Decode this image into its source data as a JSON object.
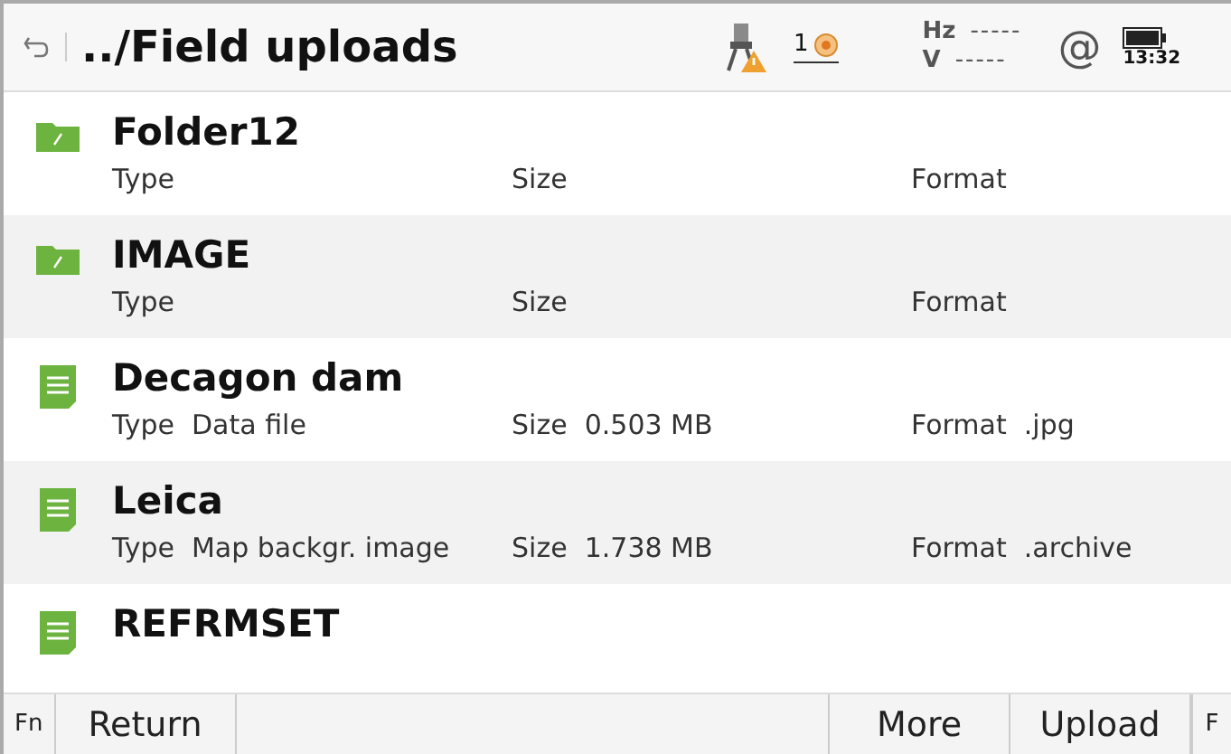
{
  "header": {
    "title": "../Field uploads",
    "prism_count": "1",
    "hz_label": "Hz",
    "hz_value": "-----",
    "v_label": "V",
    "v_value": "-----",
    "at_symbol": "@",
    "time": "13:32"
  },
  "files": [
    {
      "kind": "folder",
      "name": "Folder12",
      "details": [
        {
          "label": "Type"
        },
        {
          "label": "Size"
        },
        {
          "label": "Format"
        }
      ]
    },
    {
      "kind": "folder",
      "name": "IMAGE",
      "details": [
        {
          "label": "Type"
        },
        {
          "label": "Size"
        },
        {
          "label": "Format"
        }
      ]
    },
    {
      "kind": "file",
      "name": "Decagon dam",
      "details": [
        {
          "label": "Type",
          "value": "Data file"
        },
        {
          "label": "Size",
          "value": "0.503 MB"
        },
        {
          "label": "Format",
          "value": ".jpg"
        }
      ]
    },
    {
      "kind": "file",
      "name": "Leica",
      "details": [
        {
          "label": "Type",
          "value": "Map backgr. image"
        },
        {
          "label": "Size",
          "value": "1.738 MB"
        },
        {
          "label": "Format",
          "value": ".archive"
        }
      ]
    },
    {
      "kind": "file",
      "name": "REFRMSET"
    }
  ],
  "softkeys": {
    "fn_left": "Fn",
    "left": [
      "Return"
    ],
    "right": [
      "More",
      "Upload"
    ],
    "fn_right": "F"
  }
}
